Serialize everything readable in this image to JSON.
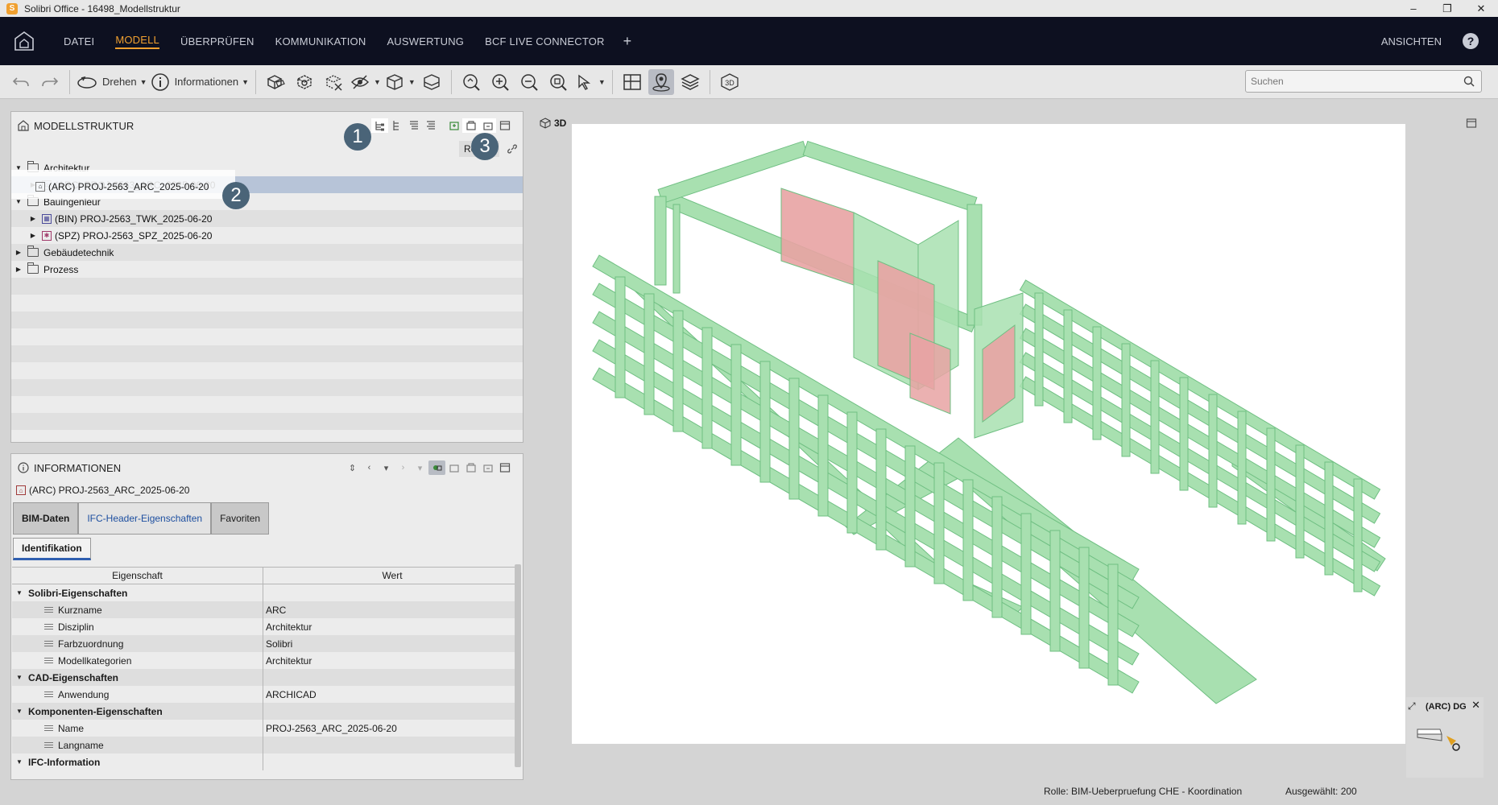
{
  "window": {
    "title": "Solibri Office - 16498_Modellstruktur",
    "logo_letter": "S",
    "controls": [
      "–",
      "❐",
      "✕"
    ]
  },
  "menu": {
    "items": [
      "DATEI",
      "MODELL",
      "ÜBERPRÜFEN",
      "KOMMUNIKATION",
      "AUSWERTUNG",
      "BCF LIVE CONNECTOR"
    ],
    "active": "MODELL",
    "plus": "+",
    "right_label": "ANSICHTEN",
    "help": "?"
  },
  "toolbar": {
    "rotate_label": "Drehen",
    "info_label": "Informationen",
    "search_placeholder": "Suchen"
  },
  "model_structure": {
    "title": "MODELLSTRUKTUR",
    "column_header": "Re",
    "tree": [
      {
        "label": "Architektur",
        "type": "folder",
        "level": 0,
        "expanded": true
      },
      {
        "label": "(ARC) PROJ-2563_ARC_2025-06-20",
        "type": "model",
        "level": 1,
        "selected": true
      },
      {
        "label": "Bauingenieur",
        "type": "folder",
        "level": 0,
        "expanded": true
      },
      {
        "label": "(BIN) PROJ-2563_TWK_2025-06-20",
        "type": "model",
        "level": 1
      },
      {
        "label": "(SPZ) PROJ-2563_SPZ_2025-06-20",
        "type": "model",
        "level": 1
      },
      {
        "label": "Gebäudetechnik",
        "type": "folder",
        "level": 0,
        "expanded": false
      },
      {
        "label": "Prozess",
        "type": "folder",
        "level": 0,
        "expanded": false
      }
    ],
    "annotations": [
      "1",
      "2",
      "3"
    ]
  },
  "information": {
    "title": "INFORMATIONEN",
    "selected_item": "(ARC) PROJ-2563_ARC_2025-06-20",
    "tabs": [
      "BIM-Daten",
      "IFC-Header-Eigenschaften",
      "Favoriten"
    ],
    "active_tab": "BIM-Daten",
    "subtab": "Identifikation",
    "columns": [
      "Eigenschaft",
      "Wert"
    ],
    "rows": [
      {
        "group": true,
        "name": "Solibri-Eigenschaften",
        "value": ""
      },
      {
        "group": false,
        "name": "Kurzname",
        "value": "ARC"
      },
      {
        "group": false,
        "name": "Disziplin",
        "value": "Architektur"
      },
      {
        "group": false,
        "name": "Farbzuordnung",
        "value": "Solibri"
      },
      {
        "group": false,
        "name": "Modellkategorien",
        "value": "Architektur"
      },
      {
        "group": true,
        "name": "CAD-Eigenschaften",
        "value": ""
      },
      {
        "group": false,
        "name": "Anwendung",
        "value": "ARCHICAD"
      },
      {
        "group": true,
        "name": "Komponenten-Eigenschaften",
        "value": ""
      },
      {
        "group": false,
        "name": "Name",
        "value": "PROJ-2563_ARC_2025-06-20"
      },
      {
        "group": false,
        "name": "Langname",
        "value": ""
      },
      {
        "group": true,
        "name": "IFC-Information",
        "value": ""
      }
    ]
  },
  "viewport": {
    "label": "3D",
    "model_color": "#a8e0b0",
    "model_edge_color": "#6fbf82",
    "highlight_color": "#e8a3a3"
  },
  "minimap": {
    "label": "(ARC) DG"
  },
  "status": {
    "role": "Rolle: BIM-Ueberpruefung CHE - Koordination",
    "selected": "Ausgewählt: 200"
  }
}
